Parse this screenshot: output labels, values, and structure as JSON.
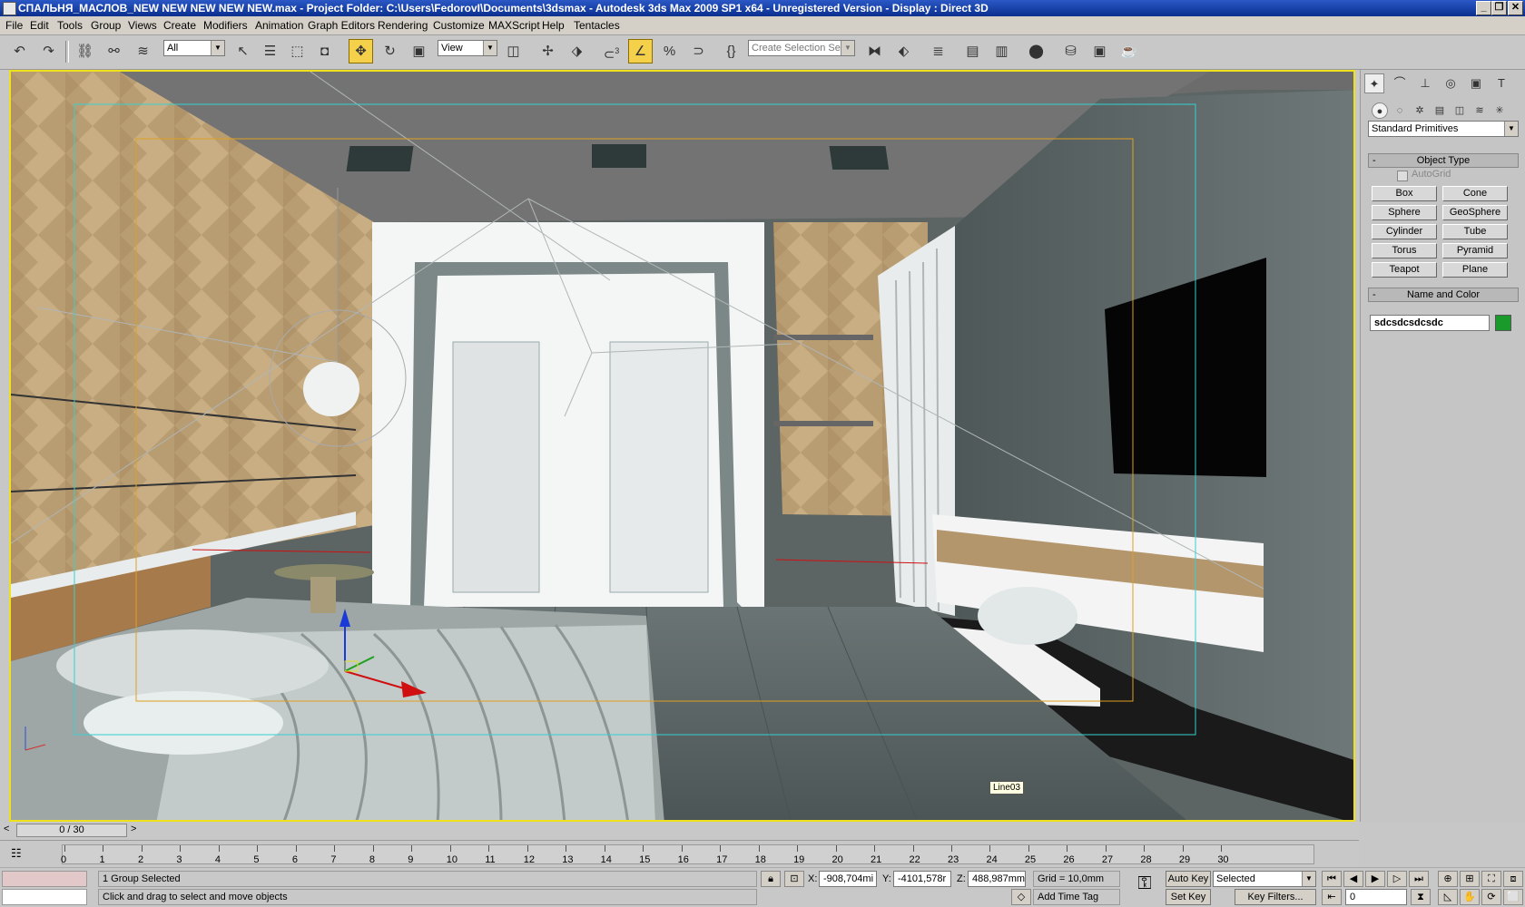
{
  "titlebar": {
    "title": "СПАЛЬНЯ_МАСЛОВ_NEW NEW NEW NEW NEW.max      - Project Folder: C:\\Users\\FedorovI\\Documents\\3dsmax      - Autodesk 3ds Max  2009 SP1  x64  - Unregistered Version      - Display : Direct 3D",
    "minimize": "_",
    "restore": "❐",
    "close": "✕"
  },
  "menu": [
    "File",
    "Edit",
    "Tools",
    "Group",
    "Views",
    "Create",
    "Modifiers",
    "Animation",
    "Graph Editors",
    "Rendering",
    "Customize",
    "MAXScript",
    "Help",
    "Tentacles"
  ],
  "toolbar": {
    "selection_filter": "All",
    "reference_coord": "View",
    "named_selection_placeholder": "Create Selection Set",
    "snap_label": "3"
  },
  "viewport": {
    "label": "",
    "tooltip": "Line03",
    "border_color": "#f0e21a"
  },
  "command_panel": {
    "dropdown": "Standard Primitives",
    "rollout_object_type": "Object Type",
    "autogrid": "AutoGrid",
    "buttons": [
      "Box",
      "Cone",
      "Sphere",
      "GeoSphere",
      "Cylinder",
      "Tube",
      "Torus",
      "Pyramid",
      "Teapot",
      "Plane"
    ],
    "rollout_name_color": "Name and Color",
    "object_name": "sdcsdcsdcsdc",
    "object_color": "#1a9a2a"
  },
  "timeline": {
    "frame_display": "0 / 30",
    "ticks": [
      "0",
      "1",
      "2",
      "3",
      "4",
      "5",
      "6",
      "7",
      "8",
      "9",
      "10",
      "11",
      "12",
      "13",
      "14",
      "15",
      "16",
      "17",
      "18",
      "19",
      "20",
      "21",
      "22",
      "23",
      "24",
      "25",
      "26",
      "27",
      "28",
      "29",
      "30"
    ]
  },
  "status": {
    "selection": "1 Group Selected",
    "prompt": "Click and drag to select and move objects",
    "x_label": "X:",
    "x_value": "-908,704mi",
    "y_label": "Y:",
    "y_value": "-4101,578r",
    "z_label": "Z:",
    "z_value": "488,987mm",
    "grid": "Grid = 10,0mm",
    "add_time_tag": "Add Time Tag",
    "auto_key": "Auto Key",
    "set_key": "Set Key",
    "key_mode": "Selected",
    "key_filters": "Key Filters...",
    "current_frame": "0"
  }
}
